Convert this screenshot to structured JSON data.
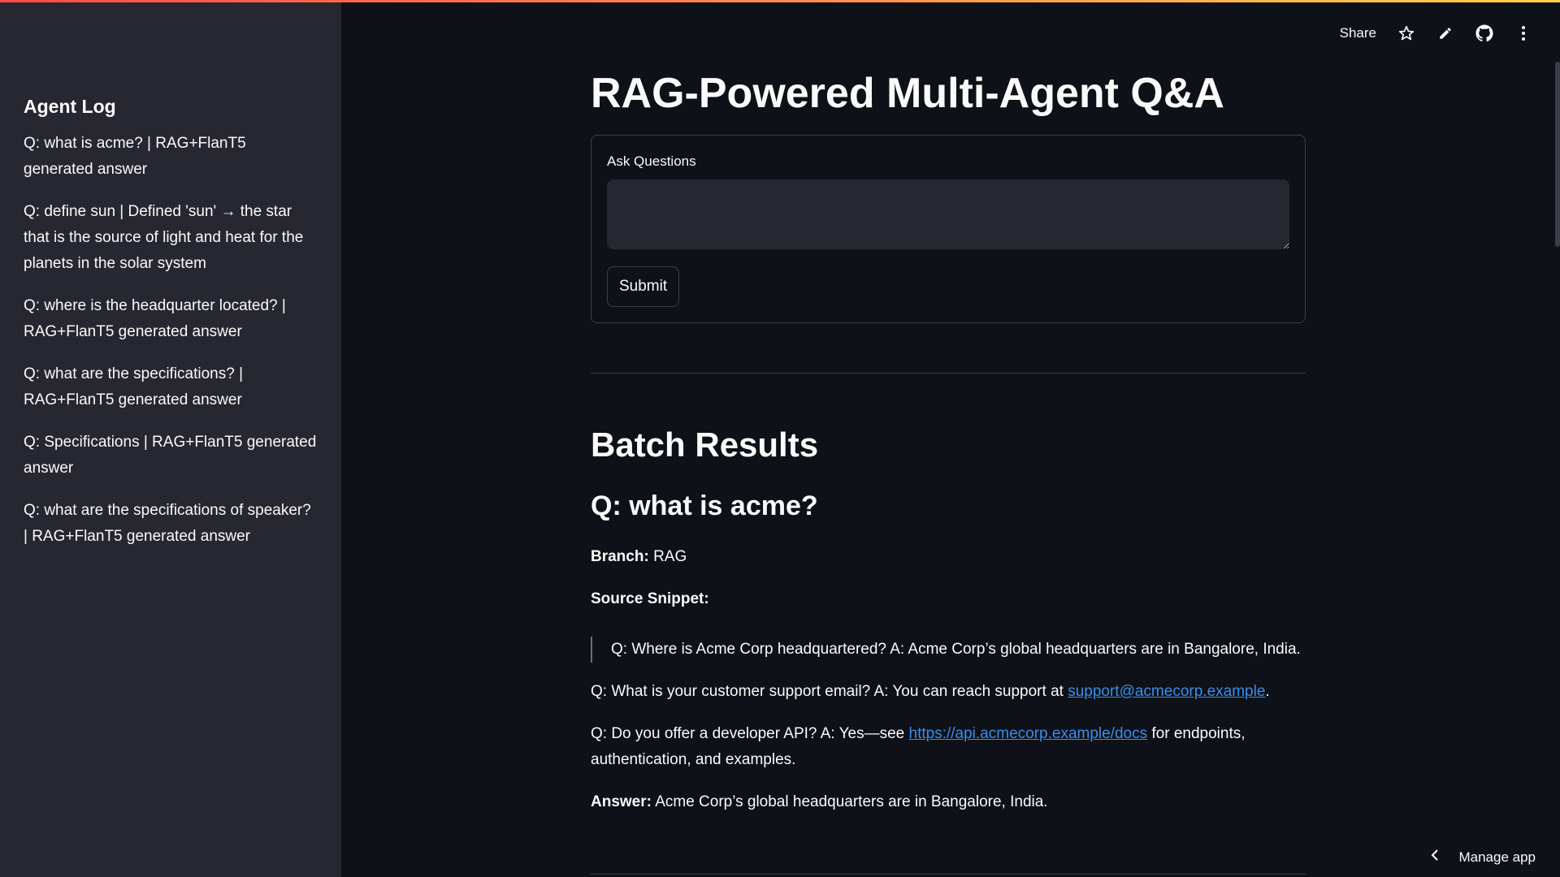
{
  "sidebar": {
    "title": "Agent Log",
    "items": [
      "Q: what is acme? | RAG+FlanT5 generated answer",
      "Q: define sun | Defined 'sun' → the star that is the source of light and heat for the planets in the solar system",
      "Q: where is the headquarter located? | RAG+FlanT5 generated answer",
      "Q: what are the specifications? | RAG+FlanT5 generated answer",
      "Q: Specifications | RAG+FlanT5 generated answer",
      "Q: what are the specifications of speaker? | RAG+FlanT5 generated answer"
    ]
  },
  "toolbar": {
    "share_label": "Share",
    "icons": [
      "star-icon",
      "pencil-icon",
      "github-icon",
      "more-vertical-icon"
    ]
  },
  "main": {
    "title": "RAG-Powered Multi-Agent Q&A",
    "form": {
      "label": "Ask Questions",
      "value": "",
      "submit_label": "Submit"
    },
    "batch_title": "Batch Results",
    "result": {
      "question": "Q: what is acme?",
      "branch_label": "Branch:",
      "branch_value": "RAG",
      "snippet_label": "Source Snippet:",
      "quote": "Q: Where is Acme Corp headquartered? A: Acme Corp’s global headquarters are in Bangalore, India.",
      "support_prefix": "Q: What is your customer support email? A: You can reach support at ",
      "support_email": "support@acmecorp.example",
      "support_suffix": ".",
      "api_prefix": "Q: Do you offer a developer API? A: Yes—see ",
      "api_link": "https://api.acmecorp.example/docs",
      "api_suffix": " for endpoints, authentication, and examples.",
      "answer_label": "Answer:",
      "answer_value": " Acme Corp’s global headquarters are in Bangalore, India."
    }
  },
  "footer": {
    "manage_label": "Manage app"
  },
  "colors": {
    "background": "#0e1117",
    "sidebar": "#262730",
    "link": "#3b8eea",
    "accent_gradient_start": "#ff4b4b",
    "accent_gradient_end": "#ffd24b"
  }
}
